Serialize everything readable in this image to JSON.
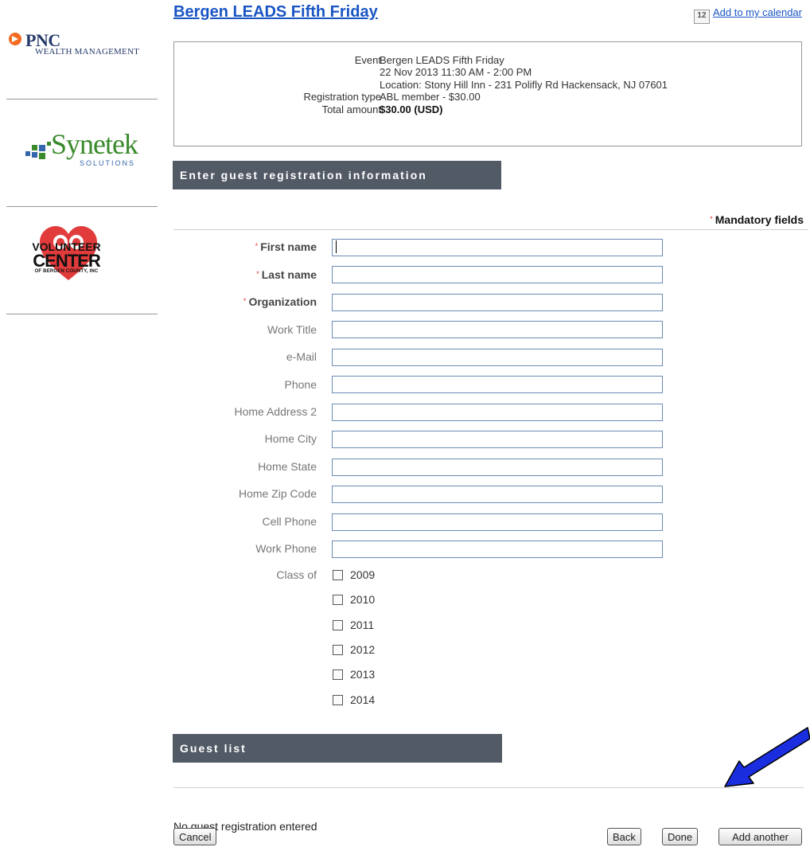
{
  "sidebar": {
    "logos": {
      "pnc_main": "PNC",
      "pnc_sub": "WEALTH MANAGEMENT",
      "synetek_main": "Synetek",
      "synetek_sub": "SOLUTIONS",
      "volunteer_1": "VOLUNTEER",
      "volunteer_2": "CENTER",
      "volunteer_3": "OF BERGEN COUNTY, INC"
    }
  },
  "header": {
    "title": "Bergen LEADS Fifth Friday",
    "calendar_icon": "12",
    "calendar_link": "Add to my calendar"
  },
  "event": {
    "event_label": "Event",
    "event_name": "Bergen LEADS Fifth Friday",
    "event_date": "22 Nov 2013 11:30 AM - 2:00 PM",
    "event_location": "Location: Stony Hill Inn - 231 Polifly Rd Hackensack, NJ 07601",
    "reg_type_label": "Registration type",
    "reg_type_value": "ABL member - $30.00",
    "total_label": "Total amount",
    "total_value": "$30.00 (USD)"
  },
  "guest_section": {
    "title": "Enter guest registration information",
    "mandatory_star": "*",
    "mandatory_label": "Mandatory fields",
    "fields": [
      {
        "label": "First name",
        "required": true,
        "value": ""
      },
      {
        "label": "Last name",
        "required": true,
        "value": ""
      },
      {
        "label": "Organization",
        "required": true,
        "value": ""
      },
      {
        "label": "Work Title",
        "required": false,
        "value": ""
      },
      {
        "label": "e-Mail",
        "required": false,
        "value": ""
      },
      {
        "label": "Phone",
        "required": false,
        "value": ""
      },
      {
        "label": "Home Address 2",
        "required": false,
        "value": ""
      },
      {
        "label": "Home City",
        "required": false,
        "value": ""
      },
      {
        "label": "Home State",
        "required": false,
        "value": ""
      },
      {
        "label": "Home Zip Code",
        "required": false,
        "value": ""
      },
      {
        "label": "Cell Phone",
        "required": false,
        "value": ""
      },
      {
        "label": "Work Phone",
        "required": false,
        "value": ""
      }
    ],
    "class_of_label": "Class of",
    "class_options": [
      "2009",
      "2010",
      "2011",
      "2012",
      "2013",
      "2014"
    ]
  },
  "guest_list": {
    "title": "Guest list",
    "empty_text": "No guest registration entered"
  },
  "buttons": {
    "cancel": "Cancel",
    "back": "Back",
    "done": "Done",
    "add_another": "Add another"
  },
  "colors": {
    "link": "#1a55c4",
    "section_header_bg": "#525a66",
    "required_star": "#dd3333",
    "annotation_arrow": "#1a2ee0"
  },
  "icons": [
    "calendar-icon",
    "annotation-arrow-icon"
  ]
}
